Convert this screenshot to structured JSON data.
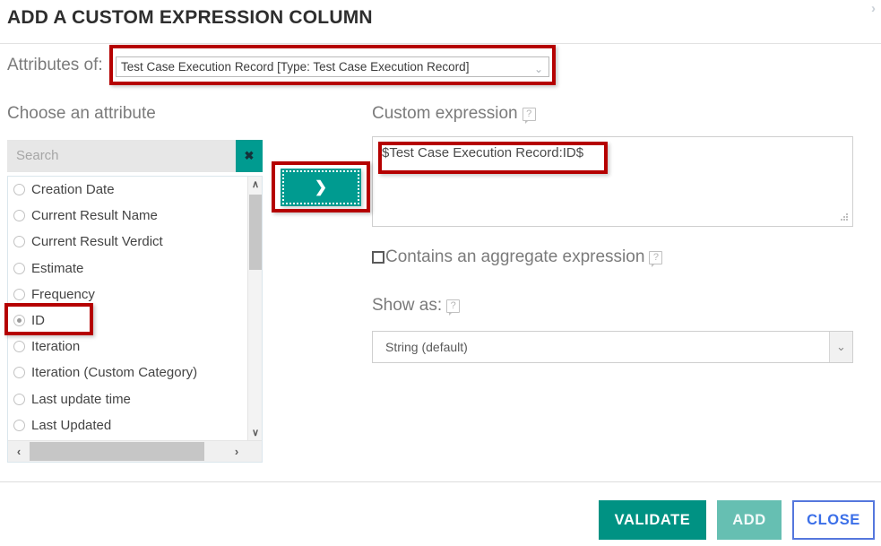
{
  "dialog": {
    "title": "ADD A CUSTOM EXPRESSION COLUMN",
    "corner_chevron": "›"
  },
  "attributes_of": {
    "label": "Attributes of:",
    "selected": "Test Case Execution Record [Type: Test Case Execution Record]",
    "chevron": "⌄"
  },
  "left_panel": {
    "heading": "Choose an attribute",
    "search": {
      "placeholder": "Search",
      "value": "",
      "clear_label": "✖"
    },
    "items": [
      {
        "label": "Creation Date",
        "checked": false
      },
      {
        "label": "Current Result Name",
        "checked": false
      },
      {
        "label": "Current Result Verdict",
        "checked": false
      },
      {
        "label": "Estimate",
        "checked": false
      },
      {
        "label": "Frequency",
        "checked": false
      },
      {
        "label": "ID",
        "checked": true
      },
      {
        "label": "Iteration",
        "checked": false
      },
      {
        "label": "Iteration (Custom Category)",
        "checked": false
      },
      {
        "label": "Last update time",
        "checked": false
      },
      {
        "label": "Last Updated",
        "checked": false
      }
    ],
    "vscroll": {
      "up": "∧",
      "down": "∨"
    },
    "hscroll": {
      "left": "‹",
      "right": "›"
    }
  },
  "transfer_button": {
    "label": "❯"
  },
  "right_panel": {
    "expression_label": "Custom expression",
    "expression_help": "?",
    "expression_value": "$Test Case Execution Record:ID$",
    "aggregate": {
      "label": "Contains an aggregate expression",
      "checked": false,
      "help": "?"
    },
    "show_as": {
      "label": "Show as:",
      "help": "?",
      "selected": "String (default)",
      "chevron": "⌄"
    }
  },
  "footer": {
    "validate_label": "VALIDATE",
    "add_label": "ADD",
    "close_label": "CLOSE"
  },
  "colors": {
    "teal": "#009b90",
    "teal_button": "#009283",
    "teal_disabled": "#66bfb2",
    "close_blue": "#3b6fe8",
    "annotation_red": "#b50000"
  }
}
